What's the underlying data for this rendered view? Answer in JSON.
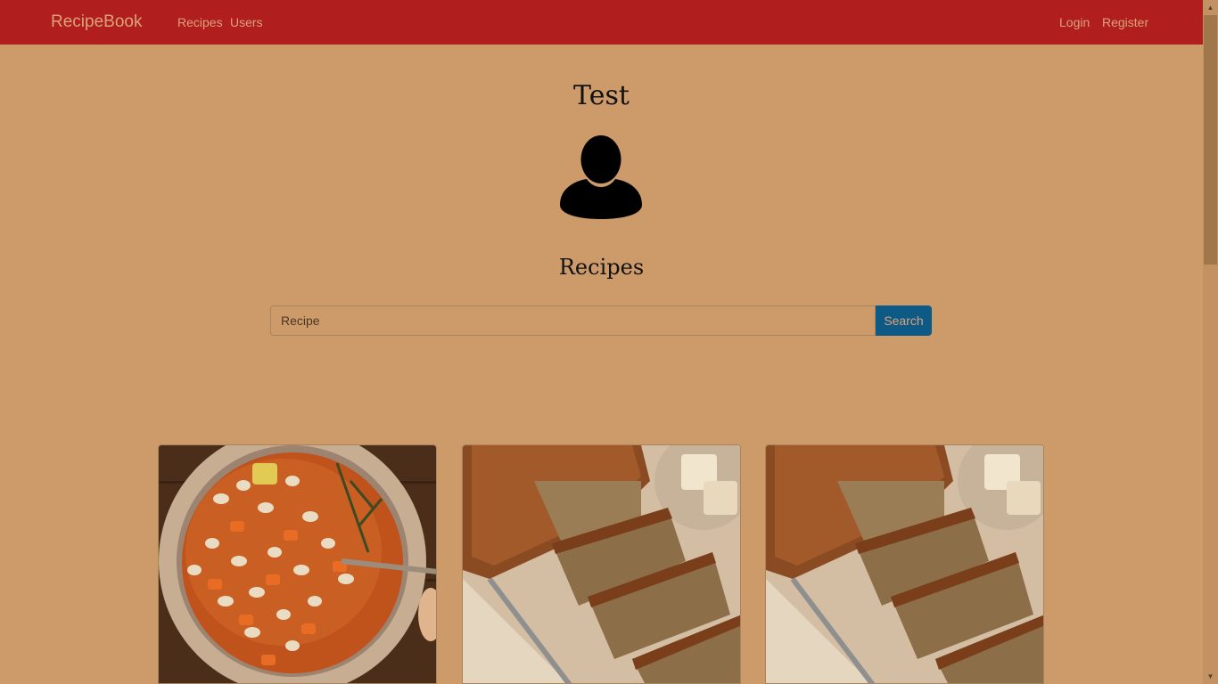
{
  "navbar": {
    "brand": "RecipeBook",
    "links": [
      "Recipes",
      "Users"
    ],
    "auth": {
      "login": "Login",
      "register": "Register"
    }
  },
  "profile": {
    "username": "Test",
    "avatar_icon": "user-silhouette-icon"
  },
  "recipes_section": {
    "title": "Recipes",
    "search": {
      "placeholder": "Recipe",
      "button_label": "Search"
    },
    "cards": [
      {
        "image": "bean-and-tomato-soup-photo"
      },
      {
        "image": "banana-bread-loaf-photo"
      },
      {
        "image": "banana-bread-loaf-photo"
      }
    ]
  },
  "colors": {
    "navbar_bg": "#b01f1e",
    "page_bg": "#cd9b6a",
    "nav_text": "#dca27a",
    "search_button_bg": "#0e5a87"
  }
}
